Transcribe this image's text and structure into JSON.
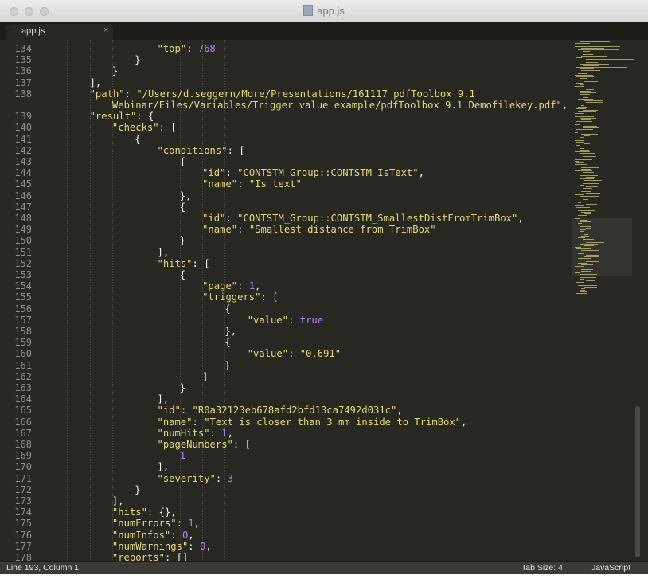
{
  "window": {
    "title": "app.js"
  },
  "tab": {
    "label": "app.js",
    "close": "×"
  },
  "status": {
    "position": "Line 193, Column 1",
    "tab_size": "Tab Size: 4",
    "syntax": "JavaScript"
  },
  "colors": {
    "background": "#272822",
    "string": "#e6db74",
    "number": "#ae81ff",
    "punctuation": "#f8f8f2",
    "gutter": "#8f908a"
  },
  "code_lines": [
    {
      "n": "134",
      "indent": 5,
      "tokens": [
        [
          "key",
          "\"top\""
        ],
        [
          "p",
          ": "
        ],
        [
          "num",
          "768"
        ]
      ]
    },
    {
      "n": "135",
      "indent": 4,
      "tokens": [
        [
          "p",
          "}"
        ]
      ]
    },
    {
      "n": "136",
      "indent": 3,
      "tokens": [
        [
          "p",
          "}"
        ]
      ]
    },
    {
      "n": "137",
      "indent": 2,
      "tokens": [
        [
          "p",
          "],"
        ]
      ]
    },
    {
      "n": "138",
      "indent": 2,
      "tokens": [
        [
          "key",
          "\"path\""
        ],
        [
          "p",
          ": "
        ],
        [
          "str",
          "\"/Users/d.seggern/More/Presentations/161117 pdfToolbox 9.1"
        ]
      ]
    },
    {
      "n": "",
      "indent": 3,
      "tokens": [
        [
          "str",
          "Webinar/Files/Variables/Trigger value example/pdfToolbox 9.1 Demofilekey.pdf\""
        ],
        [
          "p",
          ","
        ]
      ]
    },
    {
      "n": "139",
      "indent": 2,
      "tokens": [
        [
          "key",
          "\"result\""
        ],
        [
          "p",
          ": {"
        ]
      ]
    },
    {
      "n": "140",
      "indent": 3,
      "tokens": [
        [
          "key",
          "\"checks\""
        ],
        [
          "p",
          ": ["
        ]
      ]
    },
    {
      "n": "141",
      "indent": 4,
      "tokens": [
        [
          "p",
          "{"
        ]
      ]
    },
    {
      "n": "142",
      "indent": 5,
      "tokens": [
        [
          "key",
          "\"conditions\""
        ],
        [
          "p",
          ": ["
        ]
      ]
    },
    {
      "n": "143",
      "indent": 6,
      "tokens": [
        [
          "p",
          "{"
        ]
      ]
    },
    {
      "n": "144",
      "indent": 7,
      "tokens": [
        [
          "key",
          "\"id\""
        ],
        [
          "p",
          ": "
        ],
        [
          "str",
          "\"CONTSTM_Group::CONTSTM_IsText\""
        ],
        [
          "p",
          ","
        ]
      ]
    },
    {
      "n": "145",
      "indent": 7,
      "tokens": [
        [
          "key",
          "\"name\""
        ],
        [
          "p",
          ": "
        ],
        [
          "str",
          "\"Is text\""
        ]
      ]
    },
    {
      "n": "146",
      "indent": 6,
      "tokens": [
        [
          "p",
          "},"
        ]
      ]
    },
    {
      "n": "147",
      "indent": 6,
      "tokens": [
        [
          "p",
          "{"
        ]
      ]
    },
    {
      "n": "148",
      "indent": 7,
      "tokens": [
        [
          "key",
          "\"id\""
        ],
        [
          "p",
          ": "
        ],
        [
          "str",
          "\"CONTSTM_Group::CONTSTM_SmallestDistFromTrimBox\""
        ],
        [
          "p",
          ","
        ]
      ]
    },
    {
      "n": "149",
      "indent": 7,
      "tokens": [
        [
          "key",
          "\"name\""
        ],
        [
          "p",
          ": "
        ],
        [
          "str",
          "\"Smallest distance from TrimBox\""
        ]
      ]
    },
    {
      "n": "150",
      "indent": 6,
      "tokens": [
        [
          "p",
          "}"
        ]
      ]
    },
    {
      "n": "151",
      "indent": 5,
      "tokens": [
        [
          "p",
          "],"
        ]
      ]
    },
    {
      "n": "152",
      "indent": 5,
      "tokens": [
        [
          "key",
          "\"hits\""
        ],
        [
          "p",
          ": ["
        ]
      ]
    },
    {
      "n": "153",
      "indent": 6,
      "tokens": [
        [
          "p",
          "{"
        ]
      ]
    },
    {
      "n": "154",
      "indent": 7,
      "tokens": [
        [
          "key",
          "\"page\""
        ],
        [
          "p",
          ": "
        ],
        [
          "num",
          "1"
        ],
        [
          "p",
          ","
        ]
      ]
    },
    {
      "n": "155",
      "indent": 7,
      "tokens": [
        [
          "key",
          "\"triggers\""
        ],
        [
          "p",
          ": ["
        ]
      ]
    },
    {
      "n": "156",
      "indent": 8,
      "tokens": [
        [
          "p",
          "{"
        ]
      ]
    },
    {
      "n": "157",
      "indent": 9,
      "tokens": [
        [
          "key",
          "\"value\""
        ],
        [
          "p",
          ": "
        ],
        [
          "kw",
          "true"
        ]
      ]
    },
    {
      "n": "158",
      "indent": 8,
      "tokens": [
        [
          "p",
          "},"
        ]
      ]
    },
    {
      "n": "159",
      "indent": 8,
      "tokens": [
        [
          "p",
          "{"
        ]
      ]
    },
    {
      "n": "160",
      "indent": 9,
      "tokens": [
        [
          "key",
          "\"value\""
        ],
        [
          "p",
          ": "
        ],
        [
          "str",
          "\"0.691\""
        ]
      ]
    },
    {
      "n": "161",
      "indent": 8,
      "tokens": [
        [
          "p",
          "}"
        ]
      ]
    },
    {
      "n": "162",
      "indent": 7,
      "tokens": [
        [
          "p",
          "]"
        ]
      ]
    },
    {
      "n": "163",
      "indent": 6,
      "tokens": [
        [
          "p",
          "}"
        ]
      ]
    },
    {
      "n": "164",
      "indent": 5,
      "tokens": [
        [
          "p",
          "],"
        ]
      ]
    },
    {
      "n": "165",
      "indent": 5,
      "tokens": [
        [
          "key",
          "\"id\""
        ],
        [
          "p",
          ": "
        ],
        [
          "str",
          "\"R0a32123eb678afd2bfd13ca7492d031c\""
        ],
        [
          "p",
          ","
        ]
      ]
    },
    {
      "n": "166",
      "indent": 5,
      "tokens": [
        [
          "key",
          "\"name\""
        ],
        [
          "p",
          ": "
        ],
        [
          "str",
          "\"Text is closer than 3 mm inside to TrimBox\""
        ],
        [
          "p",
          ","
        ]
      ]
    },
    {
      "n": "167",
      "indent": 5,
      "tokens": [
        [
          "key",
          "\"numHits\""
        ],
        [
          "p",
          ": "
        ],
        [
          "num",
          "1"
        ],
        [
          "p",
          ","
        ]
      ]
    },
    {
      "n": "168",
      "indent": 5,
      "tokens": [
        [
          "key",
          "\"pageNumbers\""
        ],
        [
          "p",
          ": ["
        ]
      ]
    },
    {
      "n": "169",
      "indent": 6,
      "tokens": [
        [
          "num",
          "1"
        ]
      ]
    },
    {
      "n": "170",
      "indent": 5,
      "tokens": [
        [
          "p",
          "],"
        ]
      ]
    },
    {
      "n": "171",
      "indent": 5,
      "tokens": [
        [
          "key",
          "\"severity\""
        ],
        [
          "p",
          ": "
        ],
        [
          "num",
          "3"
        ]
      ]
    },
    {
      "n": "172",
      "indent": 4,
      "tokens": [
        [
          "p",
          "}"
        ]
      ]
    },
    {
      "n": "173",
      "indent": 3,
      "tokens": [
        [
          "p",
          "],"
        ]
      ]
    },
    {
      "n": "174",
      "indent": 3,
      "tokens": [
        [
          "key",
          "\"hits\""
        ],
        [
          "p",
          ": {},"
        ]
      ]
    },
    {
      "n": "175",
      "indent": 3,
      "tokens": [
        [
          "key",
          "\"numErrors\""
        ],
        [
          "p",
          ": "
        ],
        [
          "num",
          "1"
        ],
        [
          "p",
          ","
        ]
      ]
    },
    {
      "n": "176",
      "indent": 3,
      "tokens": [
        [
          "key",
          "\"numInfos\""
        ],
        [
          "p",
          ": "
        ],
        [
          "num",
          "0"
        ],
        [
          "p",
          ","
        ]
      ]
    },
    {
      "n": "177",
      "indent": 3,
      "tokens": [
        [
          "key",
          "\"numWarnings\""
        ],
        [
          "p",
          ": "
        ],
        [
          "num",
          "0"
        ],
        [
          "p",
          ","
        ]
      ]
    },
    {
      "n": "178",
      "indent": 3,
      "tokens": [
        [
          "key",
          "\"reports\""
        ],
        [
          "p",
          ": []"
        ]
      ]
    }
  ]
}
